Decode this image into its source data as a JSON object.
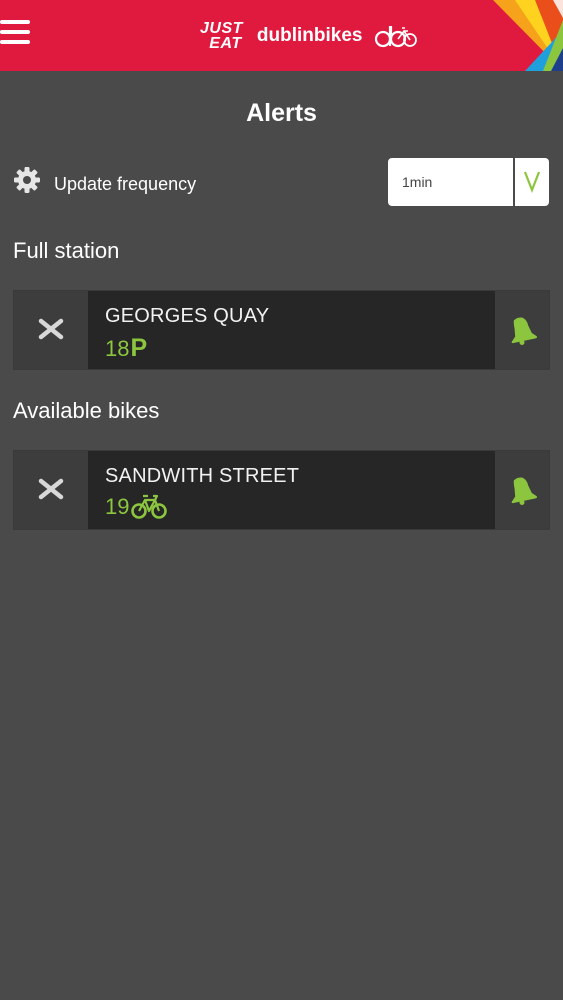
{
  "header": {
    "sponsor_line1": "JUST",
    "sponsor_line2": "EAT",
    "brand_name": "dublinbikes",
    "colors": {
      "header_bg": "#e0193f",
      "accent": "#8cc63f",
      "page_bg": "#4a4a4b"
    }
  },
  "page": {
    "title": "Alerts"
  },
  "frequency": {
    "label": "Update frequency",
    "selected": "1min",
    "chevron": "V"
  },
  "sections": [
    {
      "title": "Full station",
      "alert": {
        "station": "GEORGES QUAY",
        "count": "18",
        "type": "parking",
        "type_symbol": "P",
        "icon": "bell-icon"
      }
    },
    {
      "title": "Available bikes",
      "alert": {
        "station": "SANDWITH STREET",
        "count": "19",
        "type": "bikes",
        "icon": "bell-icon"
      }
    }
  ]
}
